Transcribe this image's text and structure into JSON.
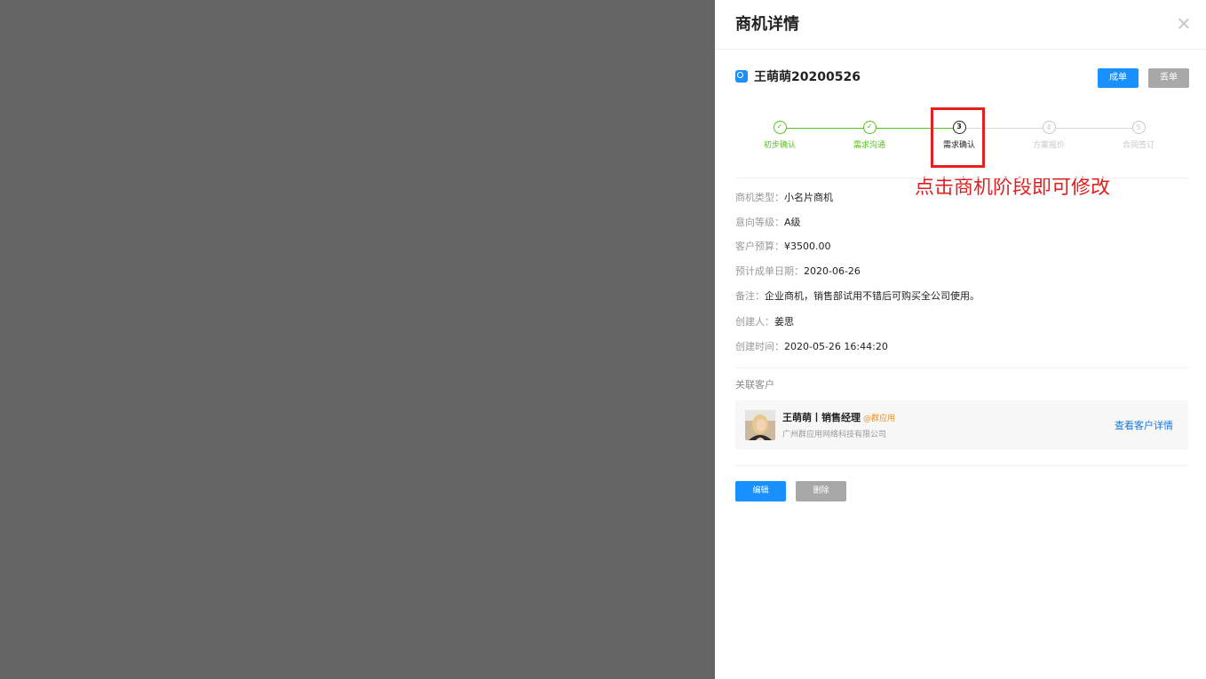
{
  "drawer": {
    "title": "商机详情",
    "close_icon": "close-icon"
  },
  "opportunity": {
    "name": "王萌萌20200526",
    "icon": "target-icon",
    "won_label": "成单",
    "lost_label": "丢单"
  },
  "stages": [
    {
      "num": "1",
      "label": "初步确认",
      "status": "done"
    },
    {
      "num": "2",
      "label": "需求沟通",
      "status": "done"
    },
    {
      "num": "3",
      "label": "需求确认",
      "status": "current"
    },
    {
      "num": "4",
      "label": "方案报价",
      "status": "pending"
    },
    {
      "num": "5",
      "label": "合同签订",
      "status": "pending"
    }
  ],
  "annotation": "点击商机阶段即可修改",
  "fields": {
    "type": {
      "key": "商机类型：",
      "value": "小名片商机"
    },
    "level": {
      "key": "意向等级：",
      "value": "A级"
    },
    "budget": {
      "key": "客户预算：",
      "value": "¥3500.00"
    },
    "close_date": {
      "key": "预计成单日期：",
      "value": "2020-06-26"
    },
    "note": {
      "key": "备注：",
      "value": "企业商机，销售部试用不错后可购买全公司使用。"
    },
    "creator": {
      "key": "创建人：",
      "value": "姜思"
    },
    "created_at": {
      "key": "创建时间：",
      "value": "2020-05-26 16:44:20"
    }
  },
  "customer": {
    "section_label": "关联客户",
    "name": "王萌萌丨销售经理",
    "tag": "@群应用",
    "company": "广州群应用网络科技有限公司",
    "view_link": "查看客户详情"
  },
  "actions": {
    "edit_label": "编辑",
    "delete_label": "删除"
  },
  "colors": {
    "primary": "#1890ff",
    "success": "#52c41a",
    "annotation": "#e02020",
    "overlay": "#646464"
  }
}
